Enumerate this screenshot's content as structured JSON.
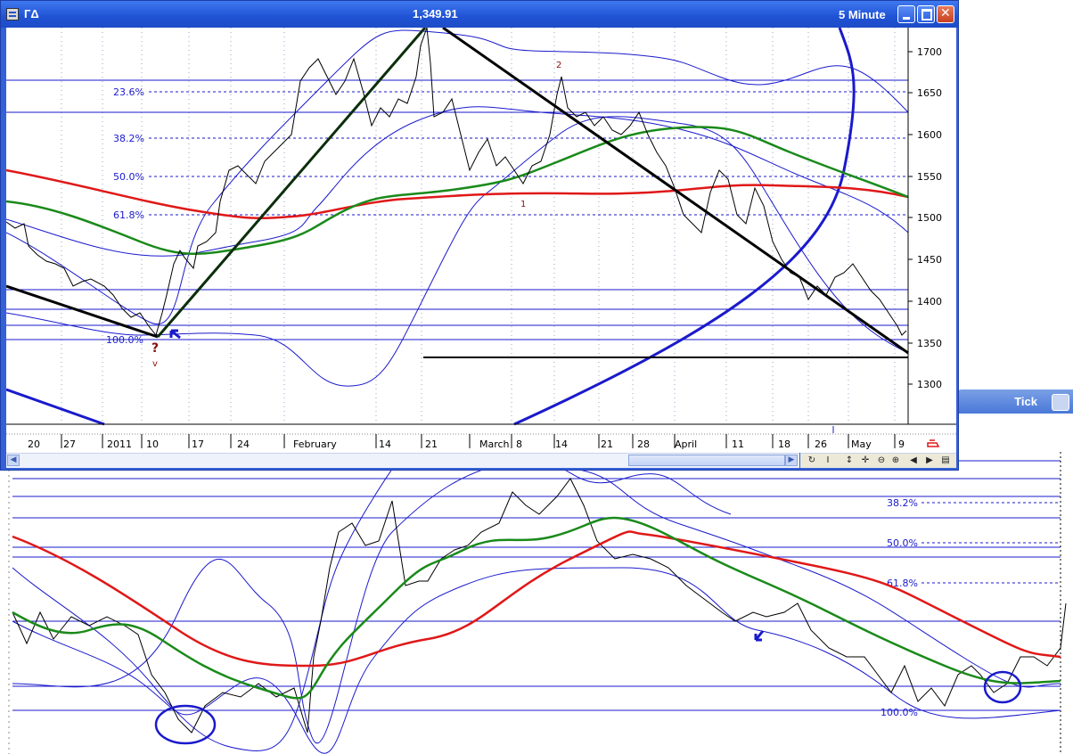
{
  "main_window": {
    "symbol": "ГΔ",
    "price": "1,349.91",
    "interval": "5 Minute"
  },
  "background_window": {
    "title": "Tick"
  },
  "top_chart": {
    "y_ticks": [
      "1700",
      "1650",
      "1600",
      "1550",
      "1500",
      "1450",
      "1400",
      "1350",
      "1300"
    ],
    "x_ticks": [
      "20",
      "27",
      "2011",
      "10",
      "17",
      "24",
      "February",
      "14",
      "21",
      "March",
      "8",
      "14",
      "21",
      "28",
      "April",
      "11",
      "18",
      "26",
      "May",
      "9"
    ],
    "fib_labels": [
      "23.6%",
      "38.2%",
      "50.0%",
      "61.8%",
      "100.0%"
    ],
    "wave_labels": [
      "2",
      "1",
      "?",
      "v"
    ]
  },
  "bottom_chart": {
    "fib_labels": [
      "38.2%",
      "50.0%",
      "61.8%",
      "100.0%"
    ]
  },
  "toolbar": {
    "icons": [
      "refresh-icon",
      "cursor-icon",
      "vertical-arrows-icon",
      "crosshair-icon",
      "zoom-out-icon",
      "zoom-in-icon",
      "scroll-left-icon",
      "scroll-right-icon",
      "window-icon"
    ]
  },
  "colors": {
    "titlebar": "#1f52d4",
    "price_line": "#000000",
    "ma_red": "#e01818",
    "ma_green": "#1a8a1a",
    "band_blue": "#1a1acc",
    "fib_blue": "#1a1acc"
  }
}
